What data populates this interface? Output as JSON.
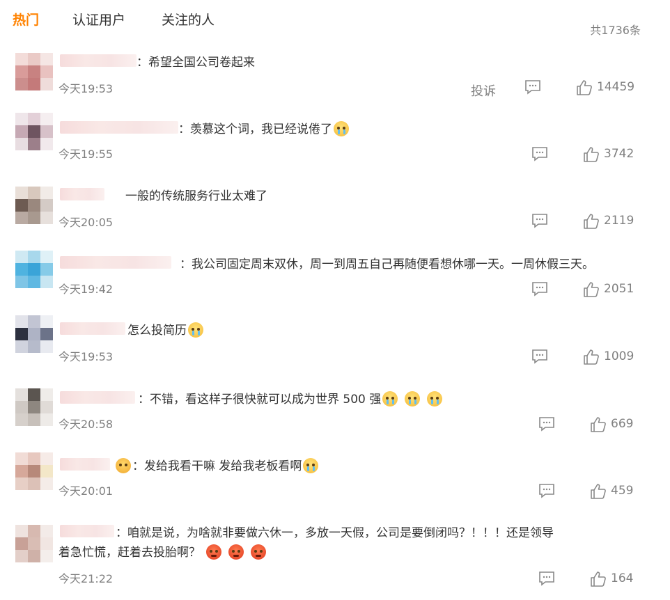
{
  "tabs": [
    {
      "label": "热门",
      "active": true
    },
    {
      "label": "认证用户",
      "active": false
    },
    {
      "label": "关注的人",
      "active": false
    }
  ],
  "total_count": "共1736条",
  "report_label": "投诉",
  "colors": {
    "accent": "#ff8200",
    "muted": "#808080",
    "text": "#333333"
  },
  "comments": [
    {
      "text": "：希望全国公司卷起来",
      "time": "今天19:53",
      "likes": "14459"
    },
    {
      "text": "：羡慕这个词，我已经说倦了",
      "time": "今天19:55",
      "likes": "3742"
    },
    {
      "text": "一般的传统服务行业太难了",
      "time": "今天20:05",
      "likes": "2119"
    },
    {
      "text": "：我公司固定周末双休，周一到周五自己再随便看想休哪一天。一周休假三天。",
      "time": "今天19:42",
      "likes": "2051"
    },
    {
      "text": "怎么投简历",
      "time": "今天19:53",
      "likes": "1009"
    },
    {
      "text": "：不错，看这样子很快就可以成为世界 500 强",
      "time": "今天20:58",
      "likes": "669"
    },
    {
      "text": "：发给我看干嘛 发给我老板看啊",
      "time": "今天20:01",
      "likes": "459"
    },
    {
      "text": "：咱就是说，为啥就非要做六休一，多放一天假，公司是要倒闭吗？！！！还是领导着急忙慌，赶着去投胎啊？",
      "time": "今天21:22",
      "likes": "164"
    }
  ]
}
